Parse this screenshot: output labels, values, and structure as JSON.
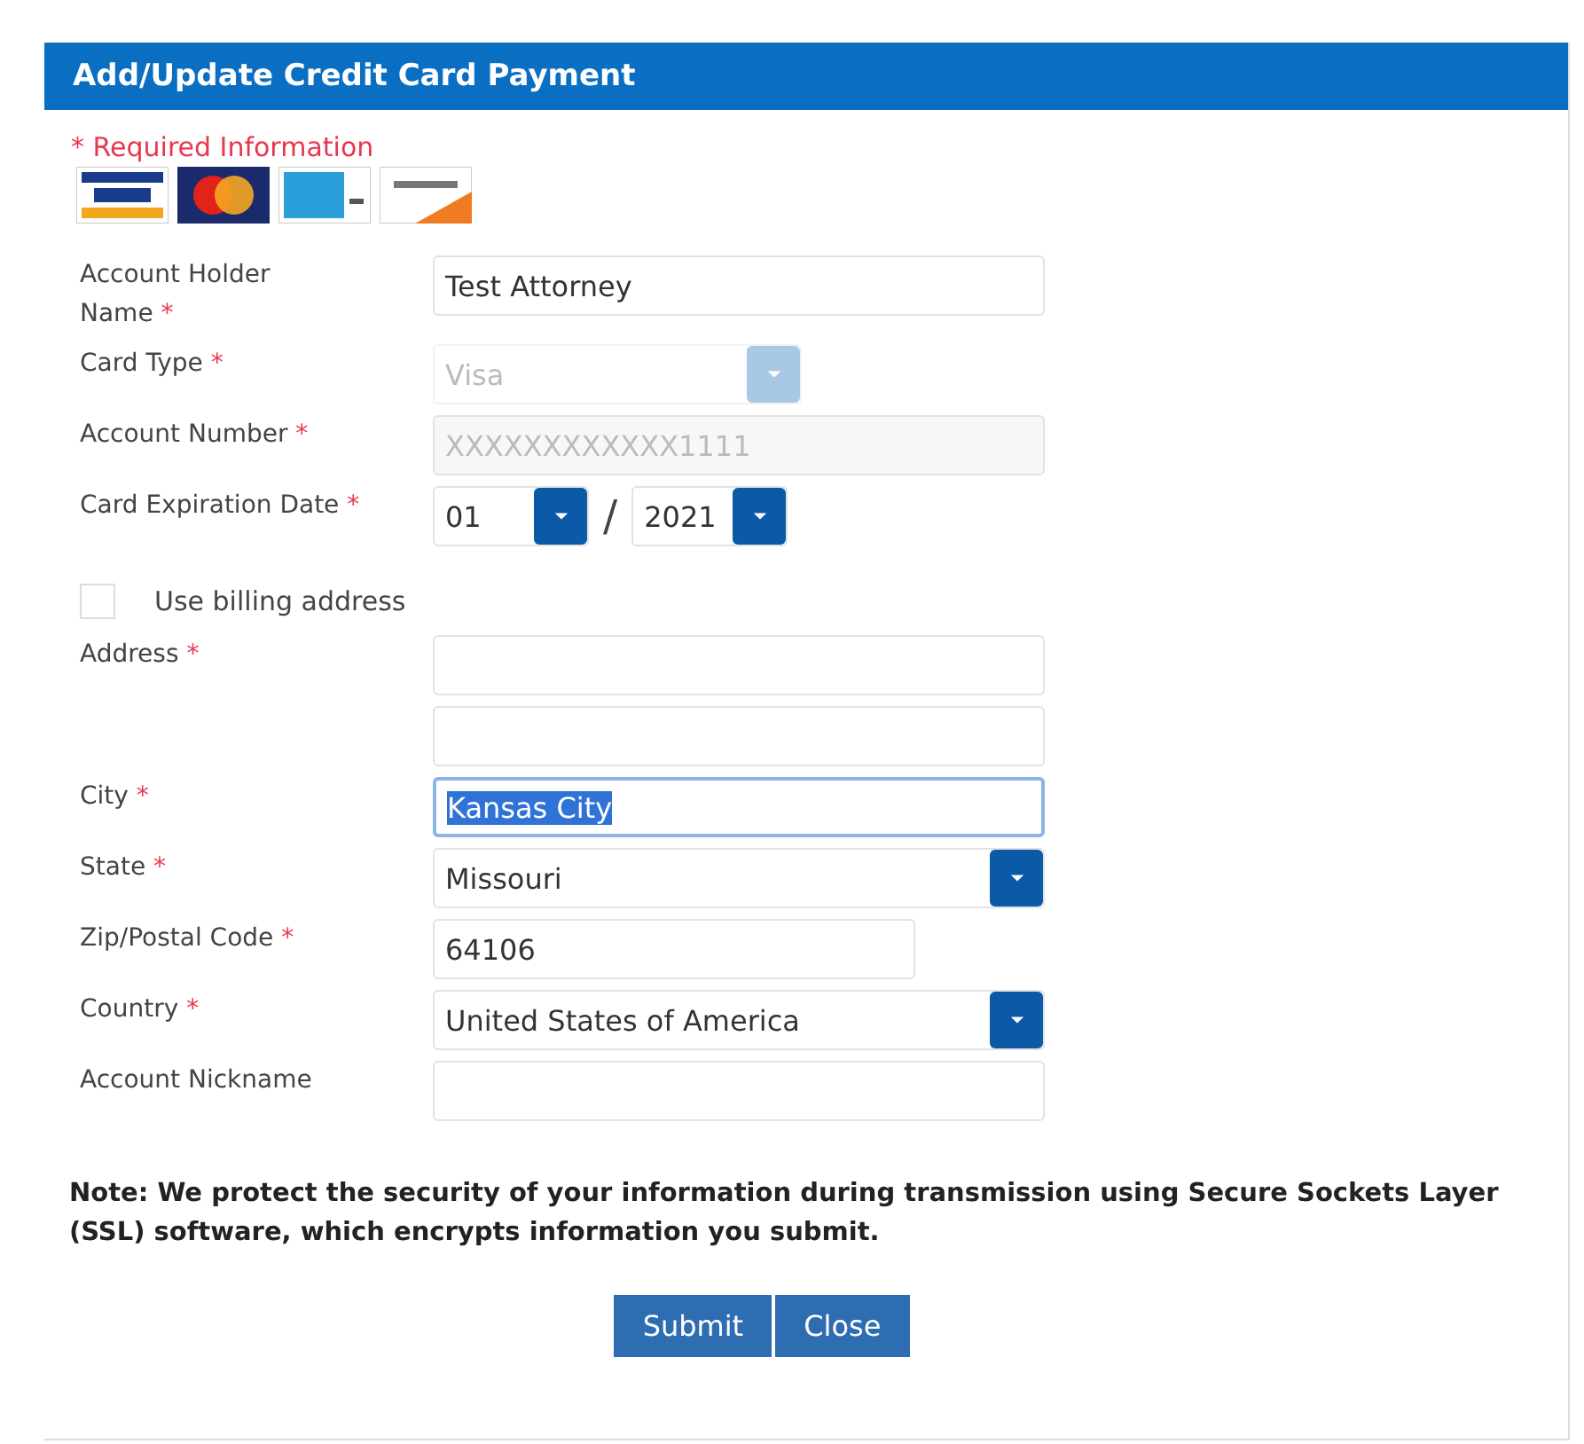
{
  "dialog": {
    "title": "Add/Update Credit Card Payment"
  },
  "required_note": "* Required Information",
  "card_logos": [
    {
      "kind": "visa"
    },
    {
      "kind": "mastercard"
    },
    {
      "kind": "amex"
    },
    {
      "kind": "discover"
    }
  ],
  "fields": [
    {
      "kind": "text",
      "label": "Account Holder Name",
      "required_mark": "*",
      "value": "Test Attorney",
      "disabled": false
    },
    {
      "kind": "select",
      "label": "Card Type",
      "required_mark": "*",
      "value": "Visa",
      "disabled": true
    },
    {
      "kind": "text",
      "label": "Account Number",
      "required_mark": "*",
      "value": "XXXXXXXXXXXX1111",
      "disabled": true
    },
    {
      "kind": "date",
      "label": "Card Expiration Date",
      "required_mark": "*",
      "month": "01",
      "separator": "/",
      "year": "2021"
    },
    {
      "kind": "checkbox",
      "label": "Use billing address",
      "checked": false
    },
    {
      "kind": "text",
      "label": "Address",
      "required_mark": "*"
    },
    {
      "kind": "text"
    },
    {
      "kind": "text",
      "label": "City",
      "required_mark": "*",
      "value": "Kansas City",
      "disabled": false,
      "focused": true
    },
    {
      "kind": "select",
      "label": "State",
      "required_mark": "*",
      "value": "Missouri",
      "disabled": false
    },
    {
      "kind": "short_text",
      "label": "Zip/Postal Code",
      "required_mark": "*",
      "value": "64106",
      "disabled": false
    },
    {
      "kind": "select",
      "label": "Country",
      "required_mark": "*",
      "value": "United States of America",
      "disabled": false
    },
    {
      "kind": "text",
      "label": "Account Nickname"
    }
  ],
  "note": "Note: We protect the security of your information during transmission using Secure Sockets Layer (SSL) software, which encrypts information you submit.",
  "buttons": [
    "Submit",
    "Close"
  ]
}
